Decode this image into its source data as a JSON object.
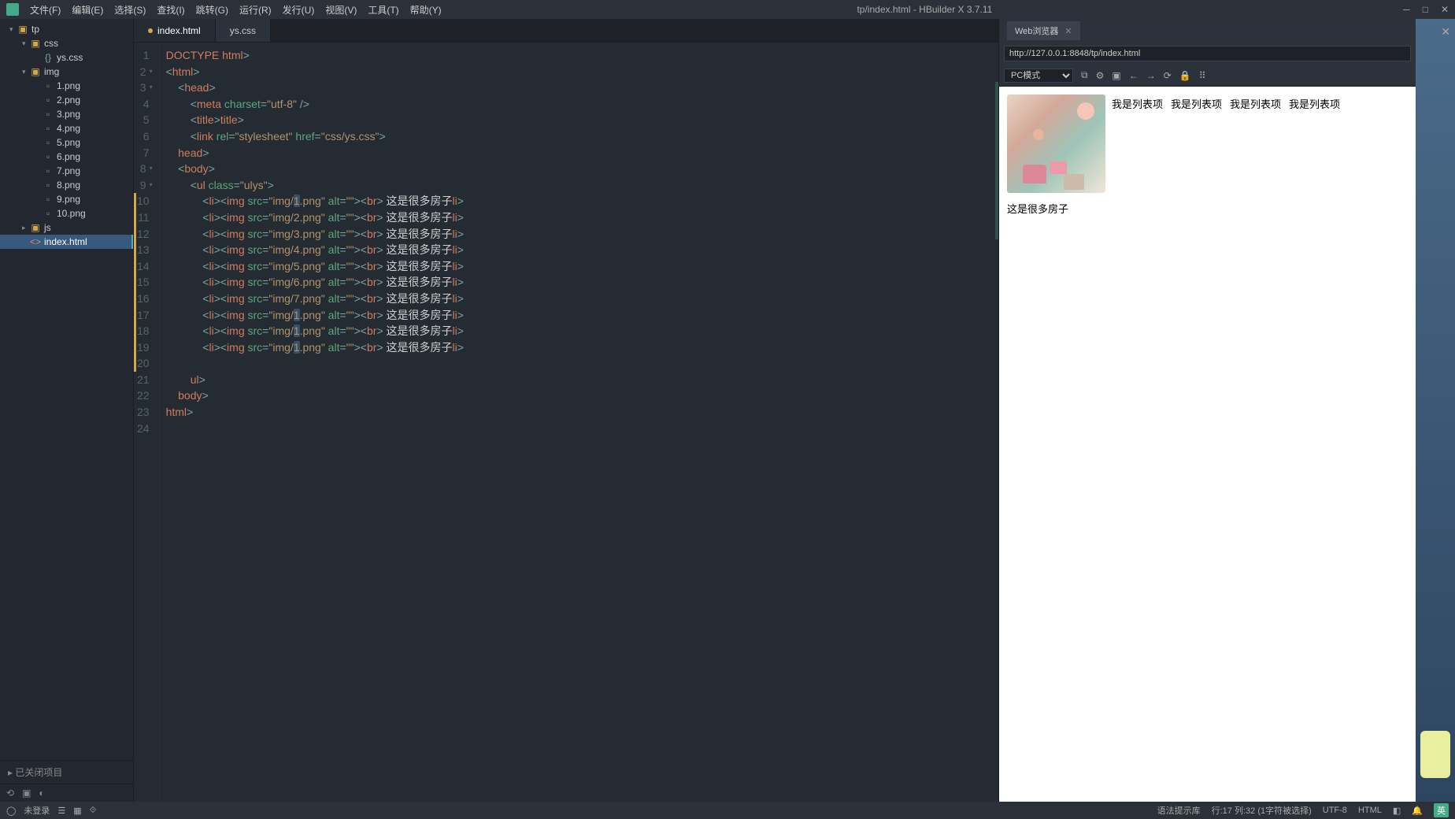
{
  "window": {
    "title": "tp/index.html - HBuilder X 3.7.11",
    "menus": [
      "文件(F)",
      "编辑(E)",
      "选择(S)",
      "查找(I)",
      "跳转(G)",
      "运行(R)",
      "发行(U)",
      "视图(V)",
      "工具(T)",
      "帮助(Y)"
    ]
  },
  "sidebar": {
    "root": "tp",
    "css_folder": "css",
    "css_file": "ys.css",
    "img_folder": "img",
    "images": [
      "1.png",
      "2.png",
      "3.png",
      "4.png",
      "5.png",
      "6.png",
      "7.png",
      "8.png",
      "9.png",
      "10.png"
    ],
    "js_folder": "js",
    "index_file": "index.html",
    "closed_projects": "已关闭项目"
  },
  "tabs": {
    "active": "index.html",
    "other": "ys.css"
  },
  "code": {
    "l1": {
      "a": "<!",
      "b": "DOCTYPE html",
      "c": ">"
    },
    "l2": {
      "a": "<",
      "b": "html",
      "c": ">"
    },
    "l3": {
      "a": "<",
      "b": "head",
      "c": ">"
    },
    "l4": {
      "a": "<",
      "b": "meta",
      "sp": " ",
      "attr": "charset",
      "eq": "=",
      "v": "\"utf-8\"",
      "end": " />"
    },
    "l5": {
      "a": "<",
      "b": "title",
      "c": "></",
      "d": "title",
      "e": ">"
    },
    "l6": {
      "a": "<",
      "b": "link",
      "sp": " ",
      "a1": "rel",
      "v1": "\"stylesheet\"",
      "a2": "href",
      "v2": "\"css/ys.css\"",
      "end": ">"
    },
    "l7": {
      "a": "</",
      "b": "head",
      "c": ">"
    },
    "l8": {
      "a": "<",
      "b": "body",
      "c": ">"
    },
    "l9": {
      "a": "<",
      "b": "ul",
      "sp": " ",
      "attr": "class",
      "v": "\"ulys\"",
      "end": ">"
    },
    "li_open": "<",
    "li": "li",
    "gt": ">",
    "img": "img",
    "srcA": " src",
    "eq": "=",
    "altA": " alt",
    "altV": "\"\"",
    "brO": "<",
    "br": "br",
    "brC": ">",
    "txt": " 这是很多房子",
    "liC": "</",
    "liE": ">",
    "srcs": [
      "\"img/1.png\"",
      "\"img/2.png\"",
      "\"img/3.png\"",
      "\"img/4.png\"",
      "\"img/5.png\"",
      "\"img/6.png\"",
      "\"img/7.png\"",
      "\"img/1.png\"",
      "\"img/1.png\"",
      "\"img/1.png\""
    ],
    "l21": {
      "a": "</",
      "b": "ul",
      "c": ">"
    },
    "l22": {
      "a": "</",
      "b": "body",
      "c": ">"
    },
    "l23": {
      "a": "</",
      "b": "html",
      "c": ">"
    }
  },
  "lines": [
    "1",
    "2",
    "3",
    "4",
    "5",
    "6",
    "7",
    "8",
    "9",
    "10",
    "11",
    "12",
    "13",
    "14",
    "15",
    "16",
    "17",
    "18",
    "19",
    "20",
    "21",
    "22",
    "23",
    "24"
  ],
  "preview": {
    "tab": "Web浏览器",
    "url": "http://127.0.0.1:8848/tp/index.html",
    "mode": "PC模式",
    "list_items": [
      "我是列表项",
      "我是列表项",
      "我是列表项",
      "我是列表项"
    ],
    "caption": "这是很多房子"
  },
  "status": {
    "login": "未登录",
    "syntax": "语法提示库",
    "pos": "行:17  列:32 (1字符被选择)",
    "enc": "UTF-8",
    "lang": "HTML",
    "ime": "英"
  }
}
